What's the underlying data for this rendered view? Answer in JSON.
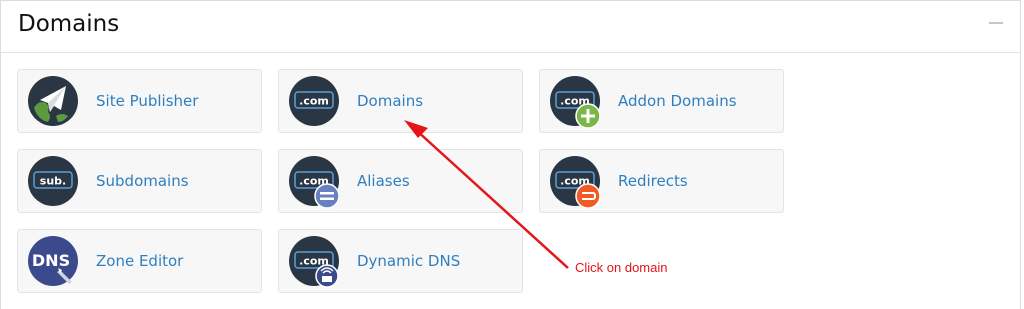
{
  "panel": {
    "title": "Domains"
  },
  "tiles": [
    {
      "label": "Site Publisher",
      "icon": "site-publisher-icon"
    },
    {
      "label": "Domains",
      "icon": "domains-icon",
      "badge_text": ".com"
    },
    {
      "label": "Addon Domains",
      "icon": "addon-domains-icon",
      "badge_text": ".com"
    },
    {
      "label": "Subdomains",
      "icon": "subdomains-icon",
      "badge_text": "sub."
    },
    {
      "label": "Aliases",
      "icon": "aliases-icon",
      "badge_text": ".com"
    },
    {
      "label": "Redirects",
      "icon": "redirects-icon",
      "badge_text": ".com"
    },
    {
      "label": "Zone Editor",
      "icon": "zone-editor-icon",
      "badge_text": "DNS"
    },
    {
      "label": "Dynamic DNS",
      "icon": "dynamic-dns-icon",
      "badge_text": ".com"
    }
  ],
  "annotation": {
    "text": "Click on domain",
    "color": "#e4161a"
  },
  "colors": {
    "link": "#2f7fbf",
    "icon_dark": "#2b3644",
    "badge_border": "#5aa0d8",
    "plus_green": "#7ab648",
    "redirect_orange": "#f15a24",
    "alias_blue": "#6a7fbf"
  }
}
